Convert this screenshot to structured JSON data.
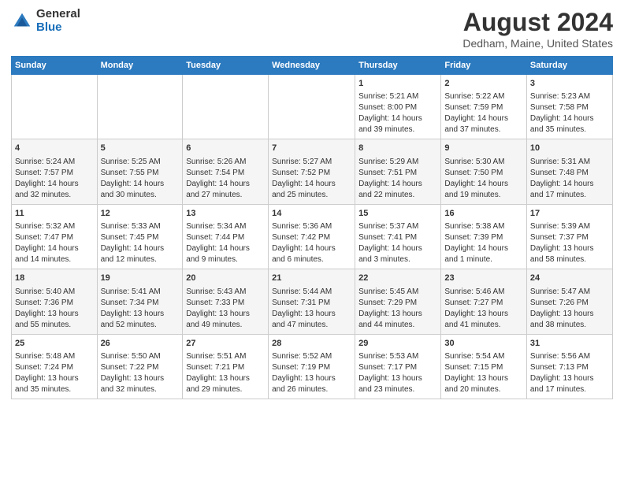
{
  "header": {
    "logo": {
      "general": "General",
      "blue": "Blue"
    },
    "title": "August 2024",
    "location": "Dedham, Maine, United States"
  },
  "days_of_week": [
    "Sunday",
    "Monday",
    "Tuesday",
    "Wednesday",
    "Thursday",
    "Friday",
    "Saturday"
  ],
  "weeks": [
    [
      {
        "day": "",
        "content": ""
      },
      {
        "day": "",
        "content": ""
      },
      {
        "day": "",
        "content": ""
      },
      {
        "day": "",
        "content": ""
      },
      {
        "day": "1",
        "content": "Sunrise: 5:21 AM\nSunset: 8:00 PM\nDaylight: 14 hours\nand 39 minutes."
      },
      {
        "day": "2",
        "content": "Sunrise: 5:22 AM\nSunset: 7:59 PM\nDaylight: 14 hours\nand 37 minutes."
      },
      {
        "day": "3",
        "content": "Sunrise: 5:23 AM\nSunset: 7:58 PM\nDaylight: 14 hours\nand 35 minutes."
      }
    ],
    [
      {
        "day": "4",
        "content": "Sunrise: 5:24 AM\nSunset: 7:57 PM\nDaylight: 14 hours\nand 32 minutes."
      },
      {
        "day": "5",
        "content": "Sunrise: 5:25 AM\nSunset: 7:55 PM\nDaylight: 14 hours\nand 30 minutes."
      },
      {
        "day": "6",
        "content": "Sunrise: 5:26 AM\nSunset: 7:54 PM\nDaylight: 14 hours\nand 27 minutes."
      },
      {
        "day": "7",
        "content": "Sunrise: 5:27 AM\nSunset: 7:52 PM\nDaylight: 14 hours\nand 25 minutes."
      },
      {
        "day": "8",
        "content": "Sunrise: 5:29 AM\nSunset: 7:51 PM\nDaylight: 14 hours\nand 22 minutes."
      },
      {
        "day": "9",
        "content": "Sunrise: 5:30 AM\nSunset: 7:50 PM\nDaylight: 14 hours\nand 19 minutes."
      },
      {
        "day": "10",
        "content": "Sunrise: 5:31 AM\nSunset: 7:48 PM\nDaylight: 14 hours\nand 17 minutes."
      }
    ],
    [
      {
        "day": "11",
        "content": "Sunrise: 5:32 AM\nSunset: 7:47 PM\nDaylight: 14 hours\nand 14 minutes."
      },
      {
        "day": "12",
        "content": "Sunrise: 5:33 AM\nSunset: 7:45 PM\nDaylight: 14 hours\nand 12 minutes."
      },
      {
        "day": "13",
        "content": "Sunrise: 5:34 AM\nSunset: 7:44 PM\nDaylight: 14 hours\nand 9 minutes."
      },
      {
        "day": "14",
        "content": "Sunrise: 5:36 AM\nSunset: 7:42 PM\nDaylight: 14 hours\nand 6 minutes."
      },
      {
        "day": "15",
        "content": "Sunrise: 5:37 AM\nSunset: 7:41 PM\nDaylight: 14 hours\nand 3 minutes."
      },
      {
        "day": "16",
        "content": "Sunrise: 5:38 AM\nSunset: 7:39 PM\nDaylight: 14 hours\nand 1 minute."
      },
      {
        "day": "17",
        "content": "Sunrise: 5:39 AM\nSunset: 7:37 PM\nDaylight: 13 hours\nand 58 minutes."
      }
    ],
    [
      {
        "day": "18",
        "content": "Sunrise: 5:40 AM\nSunset: 7:36 PM\nDaylight: 13 hours\nand 55 minutes."
      },
      {
        "day": "19",
        "content": "Sunrise: 5:41 AM\nSunset: 7:34 PM\nDaylight: 13 hours\nand 52 minutes."
      },
      {
        "day": "20",
        "content": "Sunrise: 5:43 AM\nSunset: 7:33 PM\nDaylight: 13 hours\nand 49 minutes."
      },
      {
        "day": "21",
        "content": "Sunrise: 5:44 AM\nSunset: 7:31 PM\nDaylight: 13 hours\nand 47 minutes."
      },
      {
        "day": "22",
        "content": "Sunrise: 5:45 AM\nSunset: 7:29 PM\nDaylight: 13 hours\nand 44 minutes."
      },
      {
        "day": "23",
        "content": "Sunrise: 5:46 AM\nSunset: 7:27 PM\nDaylight: 13 hours\nand 41 minutes."
      },
      {
        "day": "24",
        "content": "Sunrise: 5:47 AM\nSunset: 7:26 PM\nDaylight: 13 hours\nand 38 minutes."
      }
    ],
    [
      {
        "day": "25",
        "content": "Sunrise: 5:48 AM\nSunset: 7:24 PM\nDaylight: 13 hours\nand 35 minutes."
      },
      {
        "day": "26",
        "content": "Sunrise: 5:50 AM\nSunset: 7:22 PM\nDaylight: 13 hours\nand 32 minutes."
      },
      {
        "day": "27",
        "content": "Sunrise: 5:51 AM\nSunset: 7:21 PM\nDaylight: 13 hours\nand 29 minutes."
      },
      {
        "day": "28",
        "content": "Sunrise: 5:52 AM\nSunset: 7:19 PM\nDaylight: 13 hours\nand 26 minutes."
      },
      {
        "day": "29",
        "content": "Sunrise: 5:53 AM\nSunset: 7:17 PM\nDaylight: 13 hours\nand 23 minutes."
      },
      {
        "day": "30",
        "content": "Sunrise: 5:54 AM\nSunset: 7:15 PM\nDaylight: 13 hours\nand 20 minutes."
      },
      {
        "day": "31",
        "content": "Sunrise: 5:56 AM\nSunset: 7:13 PM\nDaylight: 13 hours\nand 17 minutes."
      }
    ]
  ]
}
